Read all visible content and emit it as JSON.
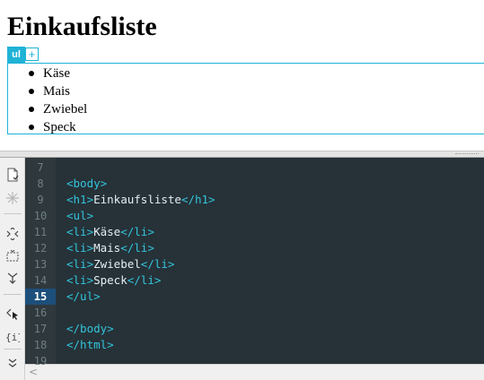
{
  "preview": {
    "title": "Einkaufsliste",
    "ul_tag_label": "ul",
    "ul_add_label": "+",
    "items": [
      "Käse",
      "Mais",
      "Zwiebel",
      "Speck"
    ]
  },
  "editor": {
    "active_line": "15",
    "lines": [
      {
        "num": "7",
        "open": "",
        "text": "",
        "close": ""
      },
      {
        "num": "8",
        "open": "<body>",
        "text": "",
        "close": ""
      },
      {
        "num": "9",
        "open": "<h1>",
        "text": "Einkaufsliste",
        "close": "</h1>"
      },
      {
        "num": "10",
        "open": "<ul>",
        "text": "",
        "close": ""
      },
      {
        "num": "11",
        "open": "<li>",
        "text": "Käse",
        "close": "</li>"
      },
      {
        "num": "12",
        "open": "<li>",
        "text": "Mais",
        "close": "</li>"
      },
      {
        "num": "13",
        "open": "<li>",
        "text": "Zwiebel",
        "close": "</li>"
      },
      {
        "num": "14",
        "open": "<li>",
        "text": "Speck",
        "close": "</li>"
      },
      {
        "num": "15",
        "open": "</ul>",
        "text": "",
        "close": ""
      },
      {
        "num": "16",
        "open": "",
        "text": "",
        "close": ""
      },
      {
        "num": "17",
        "open": "</body>",
        "text": "",
        "close": ""
      },
      {
        "num": "18",
        "open": "</html>",
        "text": "",
        "close": ""
      },
      {
        "num": "19",
        "open": "",
        "text": "",
        "close": ""
      }
    ]
  },
  "toolbar": {
    "icons": [
      "new-file-icon",
      "sparkle-icon",
      "expand-collapse-icon",
      "select-block-icon",
      "merge-lines-icon",
      "cursor-tag-icon",
      "braces-icon",
      "more-icon"
    ]
  },
  "scroll": {
    "left_arrow": "<"
  },
  "colors": {
    "editor_bg": "#263238",
    "gutter_bg": "#2f383c",
    "tag": "#33c4dc",
    "highlight_frame": "#1fb3d6",
    "active_line_bg": "#1d4f7c"
  }
}
